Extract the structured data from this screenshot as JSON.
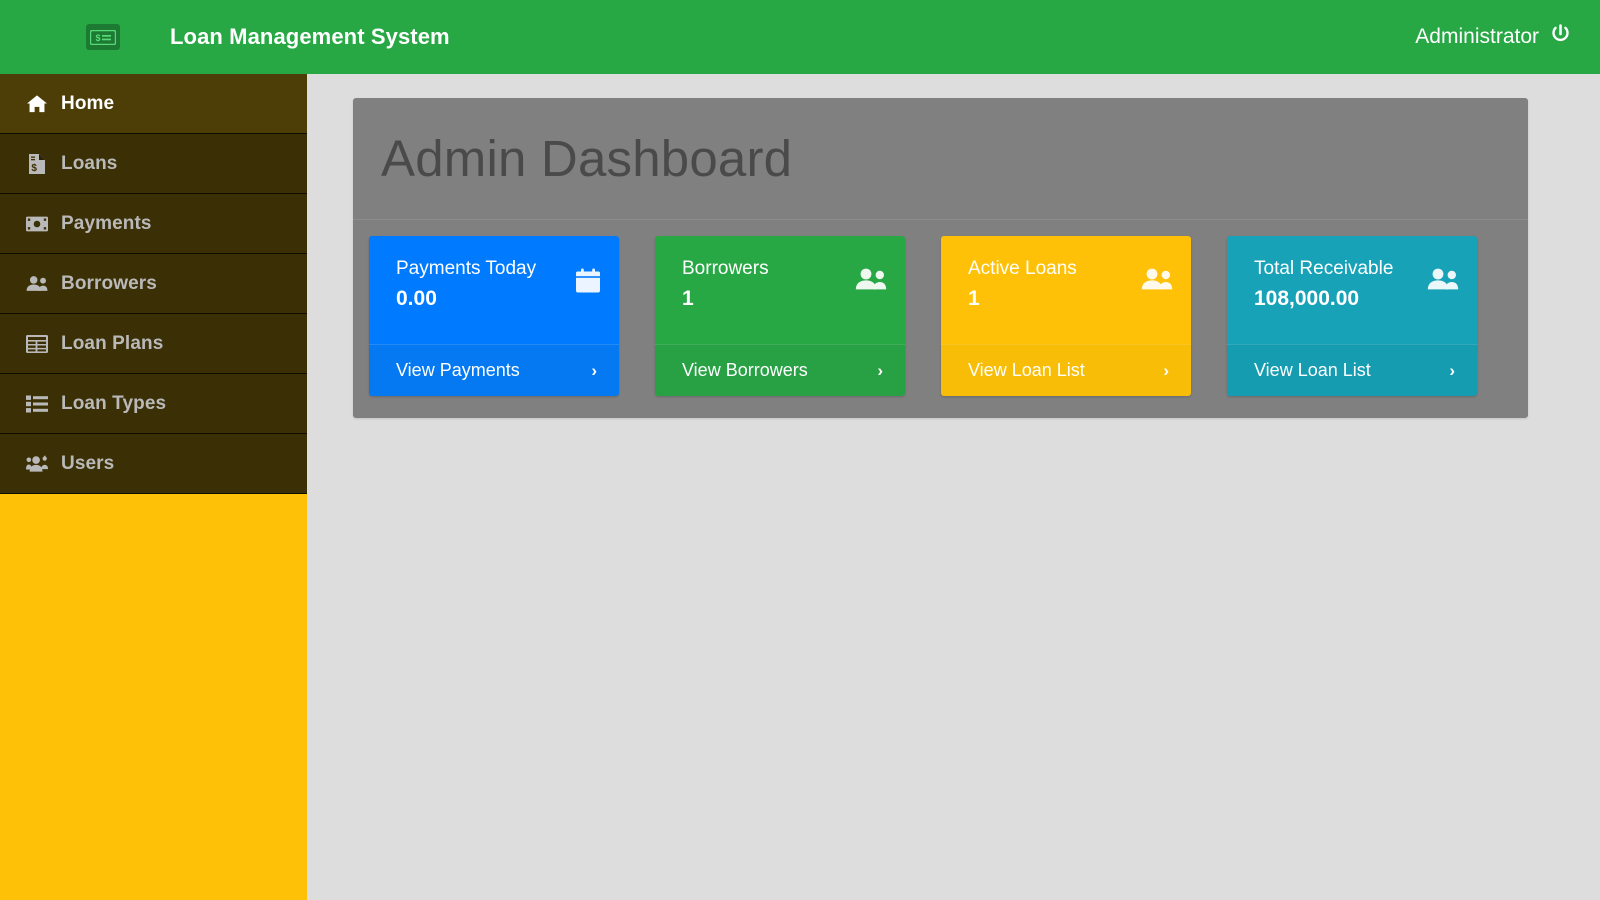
{
  "header": {
    "logo_icon": "money-bill-icon",
    "title": "Loan Management System",
    "user_label": "Administrator",
    "logout_icon": "power-off-icon",
    "bg_color": "#28a745"
  },
  "sidebar": {
    "bg_color": "#ffc107",
    "item_bg_color": "#3b2f05",
    "active_bg_color": "#4d3d06",
    "items": [
      {
        "label": "Home",
        "icon": "home-icon",
        "active": true
      },
      {
        "label": "Loans",
        "icon": "file-invoice-dollar-icon",
        "active": false
      },
      {
        "label": "Payments",
        "icon": "money-bill-icon",
        "active": false
      },
      {
        "label": "Borrowers",
        "icon": "users-icon",
        "active": false
      },
      {
        "label": "Loan Plans",
        "icon": "table-icon",
        "active": false
      },
      {
        "label": "Loan Types",
        "icon": "list-icon",
        "active": false
      },
      {
        "label": "Users",
        "icon": "users-cog-icon",
        "active": false
      }
    ]
  },
  "main": {
    "panel_title": "Admin Dashboard",
    "panel_bg_color": "#808080",
    "page_bg_color": "#dddddd",
    "cards": [
      {
        "label": "Payments Today",
        "value": "0.00",
        "icon": "calendar-icon",
        "footer_label": "View Payments",
        "chevron": "›",
        "color": "#007bff"
      },
      {
        "label": "Borrowers",
        "value": "1",
        "icon": "users-icon",
        "footer_label": "View Borrowers",
        "chevron": "›",
        "color": "#28a745"
      },
      {
        "label": "Active Loans",
        "value": "1",
        "icon": "users-icon",
        "footer_label": "View Loan List",
        "chevron": "›",
        "color": "#ffc107"
      },
      {
        "label": "Total Receivable",
        "value": "108,000.00",
        "icon": "users-icon",
        "footer_label": "View Loan List",
        "chevron": "›",
        "color": "#17a2b8"
      }
    ]
  }
}
